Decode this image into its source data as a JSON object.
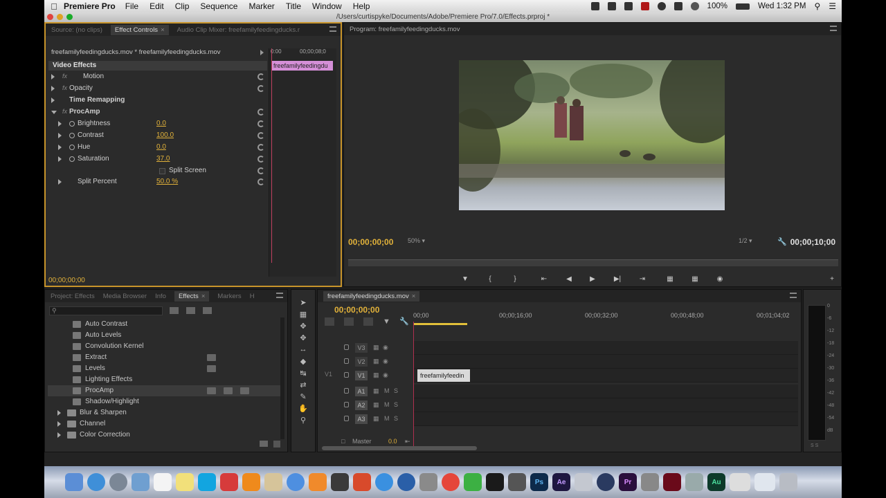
{
  "menubar": {
    "app_name": "Premiere Pro",
    "menus": [
      "File",
      "Edit",
      "Clip",
      "Sequence",
      "Marker",
      "Title",
      "Window",
      "Help"
    ],
    "battery": "100%",
    "clock": "Wed 1:32 PM"
  },
  "window": {
    "title": "/Users/curtispyke/Documents/Adobe/Premiere Pro/7.0/Effects.prproj *"
  },
  "effect_controls": {
    "tabs": [
      "Source: (no clips)",
      "Effect Controls",
      "Audio Clip Mixer: freefamilyfeedingducks.r"
    ],
    "clip_path": "freefamilyfeedingducks.mov * freefamilyfeedingducks.mov",
    "ruler_start": "0:00",
    "ruler_end": "00;00;08;0",
    "clip_label": "freefamilyfeedingdu",
    "section": "Video Effects",
    "rows": {
      "motion": "Motion",
      "opacity": "Opacity",
      "time_remap": "Time Remapping",
      "procamp": "ProcAmp",
      "brightness": {
        "label": "Brightness",
        "value": "0.0"
      },
      "contrast": {
        "label": "Contrast",
        "value": "100.0"
      },
      "hue": {
        "label": "Hue",
        "value": "0.0"
      },
      "saturation": {
        "label": "Saturation",
        "value": "37.0"
      },
      "split_screen": "Split Screen",
      "split_percent": {
        "label": "Split Percent",
        "value": "50.0 %"
      }
    },
    "current_time": "00;00;00;00"
  },
  "program": {
    "tab": "Program: freefamilyfeedingducks.mov",
    "timecode_current": "00;00;00;00",
    "zoom": "50%",
    "resolution": "1/2",
    "timecode_duration": "00;00;10;00"
  },
  "effects_panel": {
    "tabs": [
      "Project: Effects",
      "Media Browser",
      "Info",
      "Effects",
      "Markers",
      "H"
    ],
    "items": [
      {
        "name": "Auto Contrast",
        "type": "effect"
      },
      {
        "name": "Auto Levels",
        "type": "effect"
      },
      {
        "name": "Convolution Kernel",
        "type": "effect"
      },
      {
        "name": "Extract",
        "type": "effect"
      },
      {
        "name": "Levels",
        "type": "effect"
      },
      {
        "name": "Lighting Effects",
        "type": "effect"
      },
      {
        "name": "ProcAmp",
        "type": "effect",
        "selected": true
      },
      {
        "name": "Shadow/Highlight",
        "type": "effect"
      },
      {
        "name": "Blur & Sharpen",
        "type": "folder"
      },
      {
        "name": "Channel",
        "type": "folder"
      },
      {
        "name": "Color Correction",
        "type": "folder"
      }
    ]
  },
  "timeline": {
    "tab": "freefamilyfeedingducks.mov",
    "timecode": "00;00;00;00",
    "ruler": [
      "00;00",
      "00;00;16;00",
      "00;00;32;00",
      "00;00;48;00",
      "00;01;04;02"
    ],
    "tracks": [
      {
        "name": "V3",
        "src": ""
      },
      {
        "name": "V2",
        "src": ""
      },
      {
        "name": "V1",
        "src": "V1"
      },
      {
        "name": "A1",
        "src": ""
      },
      {
        "name": "A2",
        "src": ""
      },
      {
        "name": "A3",
        "src": ""
      }
    ],
    "clip_label": "freefamilyfeedin",
    "master_label": "Master",
    "master_value": "0.0",
    "toggles": {
      "mute": "M",
      "solo": "S"
    }
  },
  "meters": {
    "labels": [
      "0",
      "-6",
      "-12",
      "-18",
      "-24",
      "-30",
      "-36",
      "-42",
      "-48",
      "-54",
      "dB"
    ],
    "footer": "S S"
  },
  "dock": {
    "icons": [
      "finder-icon",
      "safari-icon",
      "launchpad-icon",
      "preview-icon",
      "calendar-icon",
      "notes-icon",
      "skype-icon",
      "flash-icon",
      "vlc-icon",
      "textedit-icon",
      "itunes-icon",
      "ibooks-icon",
      "rss-icon",
      "photobooth-icon",
      "appstore-icon",
      "quicktime-icon",
      "systemprefs-icon",
      "chrome-icon",
      "camtasia-icon",
      "terminal-icon",
      "audition-plugin-icon",
      "photoshop-icon",
      "aftereffects-icon",
      "blank-icon",
      "mediaencoder-icon",
      "premiere-icon",
      "utility-icon",
      "flash-pro-icon",
      "photo-icon",
      "audition-icon",
      "keyboard-icon",
      "folder-icon",
      "trash-icon"
    ],
    "labels": {
      "photoshop": "Ps",
      "aftereffects": "Ae",
      "premiere": "Pr",
      "audition": "Au"
    }
  },
  "colors": {
    "accent_timecode": "#e2b23a",
    "panel_active_border": "#c8942a",
    "clip_pink": "#d58fd8",
    "playhead": "#b03050"
  }
}
